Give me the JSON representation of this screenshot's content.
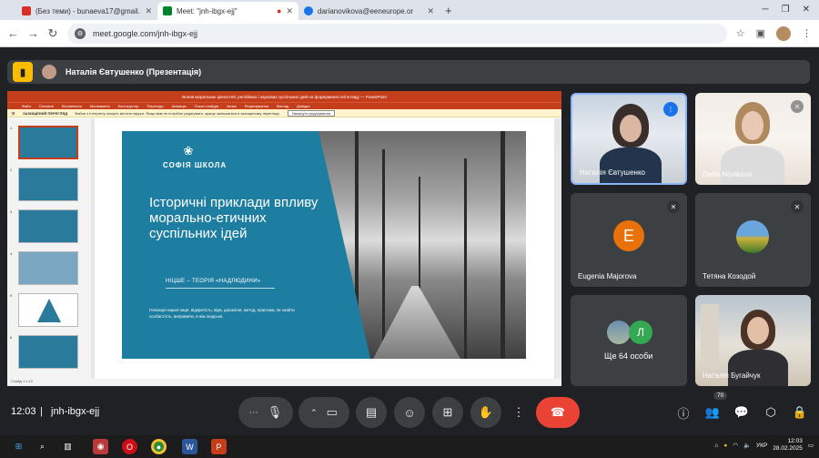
{
  "browser": {
    "tabs": [
      {
        "title": "(Без теми) - bunaeva17@gmail.c",
        "color": "#d93025"
      },
      {
        "title": "Meet: \"jnh-ibgx-ejj\"",
        "color": "#00832d",
        "active": true
      },
      {
        "title": "darianovikova@eeneurope.or",
        "color": "#1a73e8"
      }
    ],
    "new_tab": "+",
    "url": "meet.google.com/jnh-ibgx-ejj"
  },
  "meet": {
    "presenter_label": "Наталія Євтушенко (Презентація)",
    "time": "12:03",
    "meeting_code": "jnh-ibgx-ejj",
    "participants_badge": "70",
    "tiles": [
      {
        "name": "Наталія Євтушенко",
        "speaking": true
      },
      {
        "name": "Daria Novikova"
      },
      {
        "name": "Eugenia Majorova",
        "initial": "E",
        "color": "#e8710a"
      },
      {
        "name": "Тетяна Козодой"
      },
      {
        "name": "Ще 64 особи",
        "initial": "Л",
        "color": "#34a853"
      },
      {
        "name": "Наталія Бугайчук"
      }
    ]
  },
  "presentation": {
    "window_title": "Вплив моральних цінностей, релігійних і наукових суспільних ідей на формування світогляду — PowerPoint",
    "ribbon_tabs": [
      "Файл",
      "Основне",
      "Вставлення",
      "Малювання",
      "Конструктор",
      "Переходи",
      "Анімація",
      "Показ слайдів",
      "Запис",
      "Рецензування",
      "Вигляд",
      "Довідка"
    ],
    "warning_label": "ЗАХИЩЕНИЙ ПЕРЕГЛЯД",
    "warning_text": "Файли з Інтернету можуть містити віруси. Якщо вам не потрібно редагувати, краще залишатися в захищеному перегляді.",
    "enable_button": "Увімкнути редагування",
    "status": "Слайд 1 з 10",
    "slide": {
      "logo": "СОФІЯ ШКОЛА",
      "title": "Історичні приклади впливу морально-етичних суспільних ідей",
      "subtitle": "НІЦШЕ – ТЕОРІЯ «НАДЛЮДИНИ»",
      "body": "Генізація нашої нації, відкритість, віра, дошкілля, метод, практика, як знайти особистість, виправити, в нім людське."
    },
    "thumb_numbers": [
      "1",
      "2",
      "3",
      "4",
      "5",
      "6"
    ]
  },
  "taskbar": {
    "lang": "УКР",
    "time": "12:03",
    "date": "28.02.2025"
  }
}
